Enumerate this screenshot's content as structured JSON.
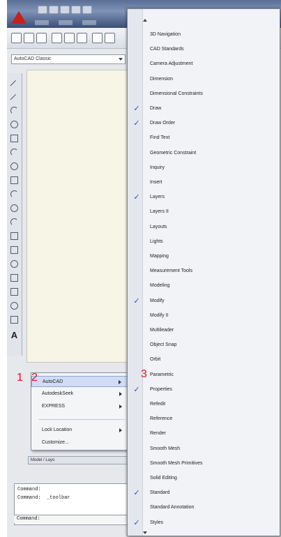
{
  "annotations": {
    "one": "1",
    "two": "2",
    "three": "3"
  },
  "workspace": {
    "selected": "AutoCAD Classic"
  },
  "context_menu": {
    "items": [
      {
        "label": "AutoCAD",
        "submenu": true,
        "highlighted": true
      },
      {
        "label": "AutodeskSeek",
        "submenu": true,
        "highlighted": false
      },
      {
        "label": "EXPRESS",
        "submenu": true,
        "highlighted": false
      },
      {
        "label": "Lock Location",
        "submenu": true,
        "highlighted": false
      },
      {
        "label": "Customize...",
        "submenu": false,
        "highlighted": false
      }
    ]
  },
  "layout_tabs": {
    "text": "Model / Layo"
  },
  "command": {
    "line1": "Command:",
    "line2": "Command:  _toolbar",
    "prompt": "Command:"
  },
  "toolbar_menu": {
    "check_glyph": "✓",
    "items": [
      {
        "label": "3D Navigation",
        "checked": false
      },
      {
        "label": "CAD Standards",
        "checked": false
      },
      {
        "label": "Camera Adjustment",
        "checked": false
      },
      {
        "label": "Dimension",
        "checked": false
      },
      {
        "label": "Dimensional Constraints",
        "checked": false
      },
      {
        "label": "Draw",
        "checked": true
      },
      {
        "label": "Draw Order",
        "checked": true
      },
      {
        "label": "Find Text",
        "checked": false
      },
      {
        "label": "Geometric Constraint",
        "checked": false
      },
      {
        "label": "Inquiry",
        "checked": false
      },
      {
        "label": "Insert",
        "checked": false
      },
      {
        "label": "Layers",
        "checked": true
      },
      {
        "label": "Layers II",
        "checked": false
      },
      {
        "label": "Layouts",
        "checked": false
      },
      {
        "label": "Lights",
        "checked": false
      },
      {
        "label": "Mapping",
        "checked": false
      },
      {
        "label": "Measurement Tools",
        "checked": false
      },
      {
        "label": "Modeling",
        "checked": false
      },
      {
        "label": "Modify",
        "checked": true
      },
      {
        "label": "Modify II",
        "checked": false
      },
      {
        "label": "Multileader",
        "checked": false
      },
      {
        "label": "Object Snap",
        "checked": false
      },
      {
        "label": "Orbit",
        "checked": false
      },
      {
        "label": "Parametric",
        "checked": false
      },
      {
        "label": "Properties",
        "checked": true
      },
      {
        "label": "Refedit",
        "checked": false
      },
      {
        "label": "Reference",
        "checked": false
      },
      {
        "label": "Render",
        "checked": false
      },
      {
        "label": "Smooth Mesh",
        "checked": false
      },
      {
        "label": "Smooth Mesh Primitives",
        "checked": false
      },
      {
        "label": "Solid Editing",
        "checked": false
      },
      {
        "label": "Standard",
        "checked": true
      },
      {
        "label": "Standard Annotation",
        "checked": false
      },
      {
        "label": "Styles",
        "checked": true
      }
    ]
  },
  "colors": {
    "annotation_red": "#e01018",
    "highlight": "#cfdcf3",
    "check_blue": "#2a55b8",
    "drawing_bg": "#f6f5e6"
  }
}
